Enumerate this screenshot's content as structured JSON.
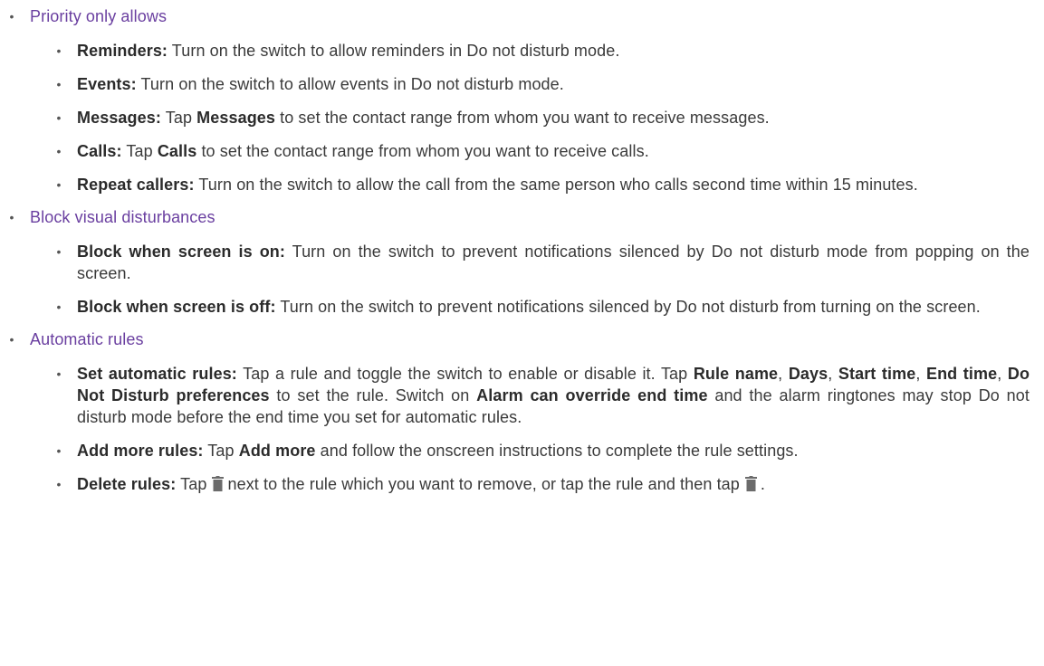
{
  "bullet_glyph": "•",
  "sections": [
    {
      "title": "Priority only allows",
      "items": [
        {
          "label": "Reminders:",
          "text": " Turn on the switch to allow reminders in Do not disturb mode."
        },
        {
          "label": "Events:",
          "text": " Turn on the switch to allow events in Do not disturb mode."
        },
        {
          "label": "Messages:",
          "t1": " Tap ",
          "b1": "Messages",
          "t2": " to set the contact range from whom you want to receive messages."
        },
        {
          "label": "Calls:",
          "t1": " Tap ",
          "b1": "Calls",
          "t2": " to set the contact range from whom you want to receive calls."
        },
        {
          "label": "Repeat callers:",
          "text": " Turn on the switch to allow the call from the same person who calls second time within 15 minutes."
        }
      ]
    },
    {
      "title": "Block visual disturbances",
      "items": [
        {
          "label": "Block when screen is on:",
          "text": " Turn on the switch to prevent notifications silenced by Do not disturb mode from popping on the screen."
        },
        {
          "label": "Block when screen is off:",
          "text": " Turn on the switch to prevent notifications silenced by Do not disturb from turning on the screen."
        }
      ]
    },
    {
      "title": "Automatic rules",
      "items": [
        {
          "label": "Set automatic rules:",
          "t1": " Tap a rule and toggle the switch to enable or disable it. Tap ",
          "b1": "Rule name",
          "t2": ", ",
          "b2": "Days",
          "t3": ", ",
          "b3": "Start time",
          "t4": ", ",
          "b4": "End time",
          "t5": ", ",
          "b5": "Do Not Disturb preferences",
          "t6": " to set the rule. Switch on ",
          "b6": "Alarm can override end time",
          "t7": " and the alarm ringtones may stop Do not disturb mode before the end time you set for automatic rules."
        },
        {
          "label": "Add more rules:",
          "t1": " Tap ",
          "b1": "Add more",
          "t2": " and follow the onscreen instructions to complete the rule settings."
        },
        {
          "label": "Delete rules:",
          "t1": " Tap",
          "t2": "next to the rule which you want to remove, or tap the rule and then tap",
          "t3": "."
        }
      ]
    }
  ],
  "icons": {
    "delete": "trash-icon"
  },
  "colors": {
    "heading": "#6a3fa0",
    "body": "#3a3a3a",
    "icon": "#6b6b6b"
  }
}
